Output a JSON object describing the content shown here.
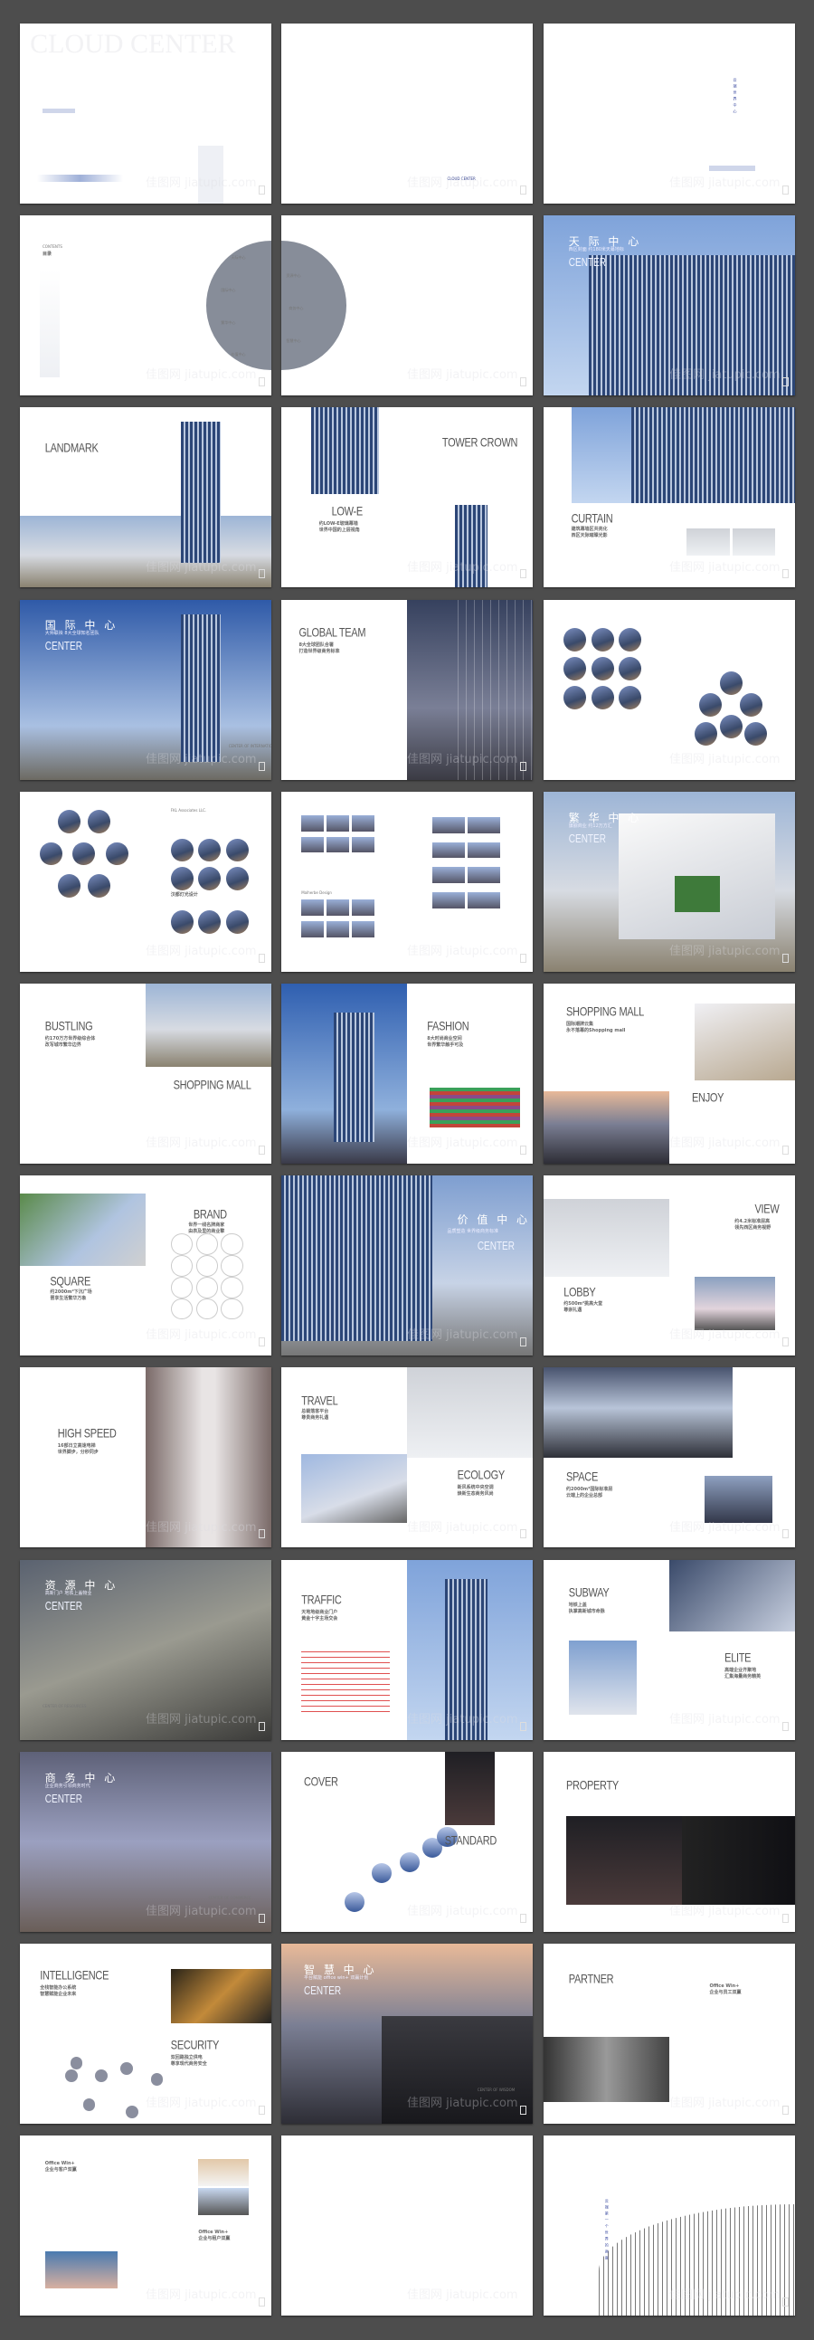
{
  "watermark": "佳图网 jiatupic.com",
  "colors": {
    "background": "#4d4d4d",
    "page": "#ffffff",
    "accent_blue": "#2c3a8a",
    "contents_circle": "#878d99"
  },
  "pages": [
    {
      "cover_title": "CLOUD CENTER"
    },
    {
      "note": "CLOUD CENTER"
    },
    {
      "vertical": "云端世界中心"
    },
    {
      "label": "CONTENTS",
      "title": "目录",
      "items": [
        "天际中心",
        "国际中心",
        "繁华中心",
        "价值中心"
      ]
    },
    {
      "items": [
        "资源中心",
        "商务中心",
        "智慧中心"
      ]
    },
    {
      "cn": "天 际 中 心",
      "sub": "西区封面 约180米天幕地标",
      "center": "CENTER"
    },
    {
      "heading": "LANDMARK"
    },
    {
      "heading": "TOWER CROWN",
      "heading2": "LOW-E",
      "cn2": "约LOW-E玻璃幕墙\n世界中国的上层视角"
    },
    {
      "heading": "CURTAIN",
      "cn": "建筑幕墙区共亮化\n西区天际璀璨光影"
    },
    {
      "cn": "国 际 中 心",
      "sub": "大师联袂 8大全球知名团队",
      "center": "CENTER",
      "caption": "CENTER OF INTERNATIONAL"
    },
    {
      "heading": "GLOBAL TEAM",
      "cn": "8大全球团队合署\n打造世界级商务标准"
    },
    {},
    {
      "heading": "FKL Associates LLC.",
      "cn2": "汉都灯光设计"
    },
    {
      "heading": "Malherbe Design"
    },
    {
      "cn": "繁 华 中 心",
      "sub": "旗舰商业 约12万方汇",
      "center": "CENTER"
    },
    {
      "heading": "BUSTLING",
      "cn": "约170万方世界级综合体\n改写城市繁华边界",
      "heading2": "SHOPPING MALL"
    },
    {
      "heading": "FASHION",
      "cn": "8大时尚商业空间\n世界繁华触手可及"
    },
    {
      "heading": "SHOPPING MALL",
      "cn": "国际潮牌云集\n永不落幕的Shopping mall",
      "heading2": "ENJOY"
    },
    {
      "heading": "BRAND",
      "cn": "世界一线名牌商家\n由表及里的商业擎",
      "heading2": "SQUARE",
      "cn2": "约2000m²下沉广场\n晋享生活繁华万象",
      "brands": [
        "YSL",
        "Dior",
        "MaxMara",
        "IWC",
        "dvf"
      ]
    },
    {
      "cn": "价 值 中 心",
      "sub": "品质塑造 世界级商务标准",
      "center": "CENTER"
    },
    {
      "heading": "VIEW",
      "cn": "约4.2米标准层高\n领先西区商务视野",
      "heading2": "LOBBY",
      "cn2": "约500m²挑高大堂\n尊崇礼遇"
    },
    {
      "heading": "HIGH SPEED",
      "cn": "16部日立高速电梯\n世界脚步，分秒同步"
    },
    {
      "heading": "TRAVEL",
      "cn": "总裁落客平台\n尊贵商务礼遇",
      "heading2": "ECOLOGY",
      "cn2": "新风系统中央空调\n焕新生态商务风尚"
    },
    {
      "heading": "SPACE",
      "cn": "约2000m²国际标准层\n云端上的企业总部"
    },
    {
      "cn": "资 源 中 心",
      "sub": "高新门户 地铁上盖物业",
      "center": "CENTER",
      "caption": "CENTER OF RESOURCES"
    },
    {
      "heading": "TRAFFIC",
      "cn": "天地地级商业门户\n黄金十字主场交会"
    },
    {
      "heading": "SUBWAY",
      "cn": "地铁上盖\n执掌高新城市命脉",
      "heading2": "ELITE",
      "cn2": "高端企业齐聚地\n汇集海量商务精英"
    },
    {
      "cn": "商 务 中 心",
      "sub": "企业商务引领商务时代",
      "center": "CENTER",
      "caption": "CENTER OF COMMERCE"
    },
    {
      "heading": "COVER",
      "heading2": "STANDARD"
    },
    {
      "heading": "PROPERTY"
    },
    {
      "heading": "INTELLIGENCE",
      "cn": "全栈智能办公系统\n智慧赋能企业未来",
      "heading2": "SECURITY",
      "cn2": "双回路独立供电\n尊享现代商务安全"
    },
    {
      "cn": "智 慧 中 心",
      "sub": "平台赋能 office win+ 双赢计划",
      "center": "CENTER",
      "caption": "CENTER OF WISDOM"
    },
    {
      "heading": "PARTNER",
      "cn2": "Office Win+\n企业与员工双赢"
    },
    {
      "cn": "Office Win+\n企业与客户双赢",
      "cn2": "Office Win+\n企业与租户双赢"
    },
    {},
    {
      "vertical": "云端第一个世界的高度"
    }
  ]
}
